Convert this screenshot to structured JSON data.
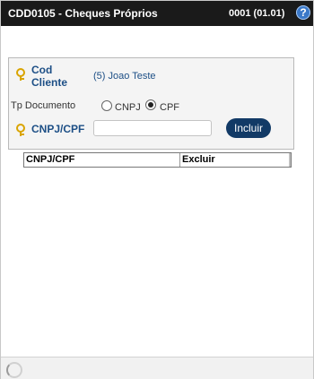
{
  "window": {
    "title": "CDD0105 - Cheques Próprios",
    "code": "0001 (01.01)",
    "help_label": "?"
  },
  "form": {
    "cod_cliente": {
      "label": "Cod Cliente",
      "value": "(5) Joao Teste"
    },
    "tp_documento": {
      "label": "Tp Documento",
      "options": [
        {
          "label": "CNPJ",
          "checked": false
        },
        {
          "label": "CPF",
          "checked": true
        }
      ]
    },
    "cnpj_cpf": {
      "label": "CNPJ/CPF",
      "value": "",
      "placeholder": ""
    },
    "include_button": "Incluir"
  },
  "table": {
    "columns": [
      "CNPJ/CPF",
      "Excluir"
    ],
    "rows": []
  },
  "icons": {
    "key": "key-icon",
    "help": "help-icon",
    "loading": "loading-icon"
  },
  "colors": {
    "titlebar": "#1a1a1a",
    "label": "#1d4f86",
    "button": "#123a66",
    "help": "#3a78c8",
    "key": "#d9a400"
  }
}
